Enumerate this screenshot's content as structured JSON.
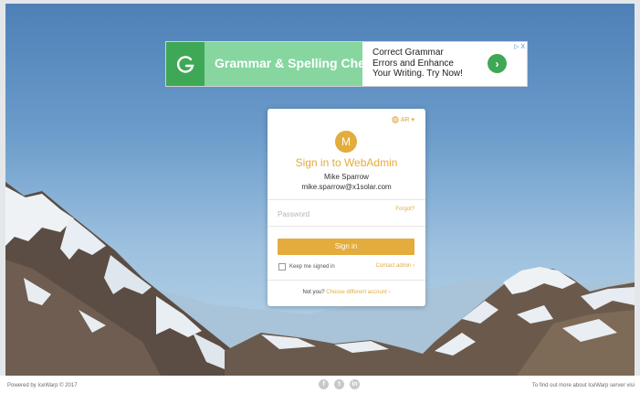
{
  "ad": {
    "title": "Grammar & Spelling Check",
    "line1": "Correct Grammar",
    "line2": "Errors and Enhance",
    "line3": "Your Writing. Try Now!",
    "logo_letter": "G",
    "arrow": "›",
    "close": "▷ X",
    "colors": {
      "panel": "#87d6a0",
      "logo_bg": "#3fa856"
    }
  },
  "login": {
    "language": "AR",
    "avatar_letter": "M",
    "title": "Sign in to WebAdmin",
    "user_name": "Mike Sparrow",
    "user_email": "mike.sparrow@x1solar.com",
    "forgot": "Forgot?",
    "password_placeholder": "Password",
    "signin_label": "Sign in",
    "keep_signed_in": "Keep me signed in",
    "contact_admin": "Contact admin ›",
    "not_you": "Not you?",
    "choose_account": "Choose different account ›",
    "accent_color": "#e3ac3d"
  },
  "footer": {
    "powered_by": "Powered by IceWarp © 2017",
    "more_info": "To find out more about IceWarp server visi",
    "social": [
      "f",
      "t",
      "in"
    ]
  }
}
